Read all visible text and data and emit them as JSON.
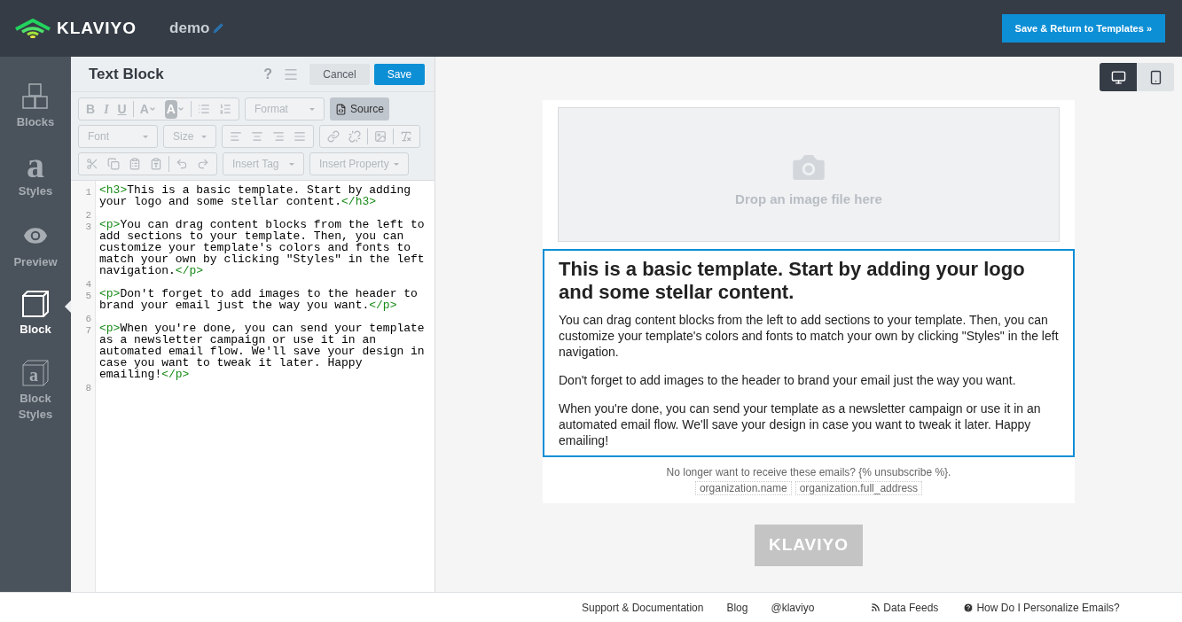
{
  "header": {
    "logo_text": "KLAVIYO",
    "template_name": "demo",
    "save_button": "Save & Return to Templates »"
  },
  "sidebar": {
    "items": [
      {
        "label": "Blocks",
        "kind": "blocks",
        "selected": false
      },
      {
        "label": "Styles",
        "kind": "styles",
        "glyph": "a",
        "selected": false
      },
      {
        "label": "Preview",
        "kind": "preview",
        "selected": false
      },
      {
        "label": "Block",
        "kind": "block",
        "selected": true
      },
      {
        "label": "Block Styles",
        "kind": "block-styles",
        "glyph": "a",
        "selected": false
      }
    ]
  },
  "editor": {
    "title": "Text Block",
    "help": "?",
    "cancel": "Cancel",
    "save": "Save",
    "toolbar": [
      [
        {
          "kind": "buttons",
          "items": [
            {
              "kind": "glyph",
              "text": "B",
              "disabled": true
            },
            {
              "kind": "glyph",
              "text": "I",
              "disabled": true
            },
            {
              "kind": "glyph",
              "text": "U",
              "disabled": true
            },
            {
              "kind": "sep"
            },
            {
              "kind": "glyph",
              "text": "A",
              "disabled": true
            },
            {
              "kind": "glyph",
              "text": "A",
              "disabled": true
            },
            {
              "kind": "sep"
            },
            {
              "kind": "icon",
              "disabled": true
            },
            {
              "kind": "icon",
              "disabled": true
            }
          ]
        },
        {
          "kind": "dropdown",
          "label": "Format",
          "disabled": true
        },
        {
          "kind": "toggle",
          "label": "Source",
          "selected": true
        }
      ],
      [
        {
          "kind": "dropdown",
          "label": "Font",
          "disabled": true
        },
        {
          "kind": "dropdown",
          "label": "Size",
          "disabled": true
        },
        {
          "kind": "buttons",
          "items": [
            {
              "kind": "icon",
              "disabled": true
            },
            {
              "kind": "icon",
              "disabled": true
            },
            {
              "kind": "icon",
              "disabled": true
            },
            {
              "kind": "icon",
              "disabled": true
            }
          ]
        },
        {
          "kind": "buttons",
          "items": [
            {
              "kind": "icon",
              "disabled": true
            },
            {
              "kind": "icon",
              "disabled": true
            },
            {
              "kind": "sep"
            },
            {
              "kind": "icon",
              "disabled": true
            },
            {
              "kind": "sep"
            },
            {
              "kind": "icon",
              "disabled": true
            }
          ]
        }
      ],
      [
        {
          "kind": "buttons",
          "items": [
            {
              "kind": "icon",
              "disabled": true
            },
            {
              "kind": "icon",
              "disabled": true
            },
            {
              "kind": "icon",
              "disabled": true
            },
            {
              "kind": "icon",
              "disabled": true
            },
            {
              "kind": "sep"
            },
            {
              "kind": "icon",
              "disabled": true
            },
            {
              "kind": "icon",
              "disabled": true
            }
          ]
        },
        {
          "kind": "dropdown",
          "label": "Insert Tag",
          "disabled": true
        },
        {
          "kind": "dropdown",
          "label": "Insert Property",
          "disabled": true
        }
      ]
    ],
    "code_lines": [
      {
        "number": "1",
        "rows": [
          [
            {
              "kind": "tag",
              "text": "<h3>"
            },
            {
              "kind": "text",
              "text": "This is a basic template. Start by adding"
            }
          ],
          [
            {
              "kind": "text",
              "text": "your logo and some stellar content."
            },
            {
              "kind": "tag",
              "text": "</h3>"
            }
          ]
        ]
      },
      {
        "number": "2",
        "rows": [
          []
        ]
      },
      {
        "number": "3",
        "rows": [
          [
            {
              "kind": "tag",
              "text": "<p>"
            },
            {
              "kind": "text",
              "text": "You can drag content blocks from the left to"
            }
          ],
          [
            {
              "kind": "text",
              "text": "add sections to your template. Then, you can"
            }
          ],
          [
            {
              "kind": "text",
              "text": "customize your template's colors and fonts to"
            }
          ],
          [
            {
              "kind": "text",
              "text": "match your own by clicking \"Styles\" in the left"
            }
          ],
          [
            {
              "kind": "text",
              "text": "navigation."
            },
            {
              "kind": "tag",
              "text": "</p>"
            }
          ]
        ]
      },
      {
        "number": "4",
        "rows": [
          []
        ]
      },
      {
        "number": "5",
        "rows": [
          [
            {
              "kind": "tag",
              "text": "<p>"
            },
            {
              "kind": "text",
              "text": "Don't forget to add images to the header to"
            }
          ],
          [
            {
              "kind": "text",
              "text": "brand your email just the way you want."
            },
            {
              "kind": "tag",
              "text": "</p>"
            }
          ]
        ]
      },
      {
        "number": "6",
        "rows": [
          []
        ]
      },
      {
        "number": "7",
        "rows": [
          [
            {
              "kind": "tag",
              "text": "<p>"
            },
            {
              "kind": "text",
              "text": "When you're done, you can send your template"
            }
          ],
          [
            {
              "kind": "text",
              "text": "as a newsletter campaign or use it in an"
            }
          ],
          [
            {
              "kind": "text",
              "text": "automated email flow. We'll save your design in"
            }
          ],
          [
            {
              "kind": "text",
              "text": "case you want to tweak it later. Happy"
            }
          ],
          [
            {
              "kind": "text",
              "text": "emailing!"
            },
            {
              "kind": "tag",
              "text": "</p>"
            }
          ]
        ]
      },
      {
        "number": "8",
        "rows": [
          []
        ]
      }
    ]
  },
  "preview": {
    "devices": [
      {
        "kind": "desktop",
        "selected": true
      },
      {
        "kind": "mobile",
        "selected": false
      }
    ],
    "image_placeholder": "Drop an image file here",
    "heading": "This is a basic template. Start by adding your logo and some stellar content.",
    "paragraphs": [
      "You can drag content blocks from the left to add sections to your template. Then, you can customize your template's colors and fonts to match your own by clicking \"Styles\" in the left navigation.",
      "Don't forget to add images to the header to brand your email just the way you want.",
      "When you're done, you can send your template as a newsletter campaign or use it in an automated email flow. We'll save your design in case you want to tweak it later. Happy emailing!"
    ],
    "unsubscribe": "No longer want to receive these emails? {% unsubscribe %}.",
    "org_tags": [
      "organization.name",
      "organization.full_address"
    ],
    "badge": "KLAVIYO"
  },
  "footer": {
    "links": [
      {
        "label": "Support & Documentation",
        "kind": "plain"
      },
      {
        "label": "Blog",
        "kind": "plain"
      },
      {
        "label": "@klaviyo",
        "kind": "plain"
      },
      {
        "label": "Data Feeds",
        "kind": "rss"
      },
      {
        "label": "How Do I Personalize Emails?",
        "kind": "help"
      }
    ]
  }
}
